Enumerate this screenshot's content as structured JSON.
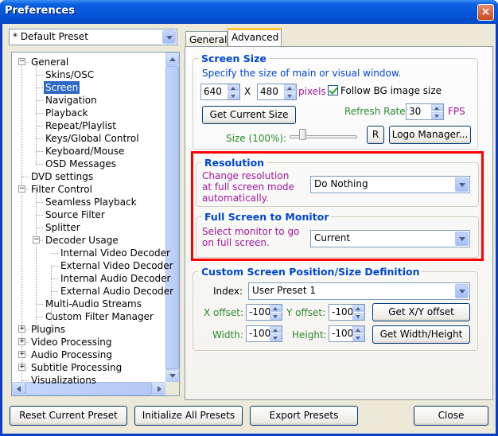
{
  "window": {
    "title": "Preferences",
    "close_glyph": "×"
  },
  "preset": {
    "selected": "* Default Preset"
  },
  "tree": {
    "items": [
      {
        "label": "General",
        "expander": "−"
      },
      {
        "label": "Skins/OSC"
      },
      {
        "label": "Screen"
      },
      {
        "label": "Navigation"
      },
      {
        "label": "Playback"
      },
      {
        "label": "Repeat/Playlist"
      },
      {
        "label": "Keys/Global Control"
      },
      {
        "label": "Keyboard/Mouse"
      },
      {
        "label": "OSD Messages"
      },
      {
        "label": "DVD settings"
      },
      {
        "label": "Filter Control",
        "expander": "−"
      },
      {
        "label": "Seamless Playback"
      },
      {
        "label": "Source Filter"
      },
      {
        "label": "Splitter"
      },
      {
        "label": "Decoder Usage",
        "expander": "−"
      },
      {
        "label": "Internal Video Decoder"
      },
      {
        "label": "External Video Decoder"
      },
      {
        "label": "Internal Audio Decoder"
      },
      {
        "label": "External Audio Decoder"
      },
      {
        "label": "Multi-Audio Streams"
      },
      {
        "label": "Custom Filter Manager"
      },
      {
        "label": "Plugins",
        "expander": "+"
      },
      {
        "label": "Video Processing",
        "expander": "+"
      },
      {
        "label": "Audio Processing",
        "expander": "+"
      },
      {
        "label": "Subtitle Processing",
        "expander": "+"
      },
      {
        "label": "Visualizations"
      }
    ],
    "selected": "Screen"
  },
  "tabs": [
    {
      "label": "General"
    },
    {
      "label": "Advanced"
    }
  ],
  "screen_size": {
    "title": "Screen Size",
    "description": "Specify the size of main or visual window.",
    "width": "640",
    "x_label": "X",
    "height": "480",
    "unit": "pixels",
    "follow_bg_label": "Follow BG image size",
    "follow_bg_checked": true,
    "get_current_label": "Get Current Size",
    "refresh_label": "Refresh Rate:",
    "refresh_value": "30",
    "fps_label": "FPS",
    "size_label": "Size (100%):",
    "r_label": "R",
    "logo_manager_label": "Logo Manager..."
  },
  "resolution": {
    "title": "Resolution",
    "desc_line1": "Change resolution",
    "desc_line2": "at full screen mode",
    "desc_line3": "automatically.",
    "selected": "Do Nothing"
  },
  "full_screen": {
    "title": "Full Screen to Monitor",
    "desc_line1": "Select monitor to go",
    "desc_line2": "on full screen.",
    "selected": "Current"
  },
  "custom_pos": {
    "title": "Custom Screen Position/Size Definition",
    "index_label": "Index:",
    "index_value": "User Preset 1",
    "x_offset_label": "X offset:",
    "x_offset_value": "-100",
    "y_offset_label": "Y offset:",
    "y_offset_value": "-100",
    "get_xy_label": "Get X/Y offset",
    "width_label": "Width:",
    "width_value": "-100",
    "height_label": "Height:",
    "height_value": "-100",
    "get_wh_label": "Get Width/Height"
  },
  "footer": {
    "reset_label": "Reset Current Preset",
    "init_label": "Initialize All Presets",
    "export_label": "Export Presets",
    "close_label": "Close"
  },
  "colors": {
    "title_bar": "#0553d8",
    "group_title": "#0046d5",
    "highlight_box": "#ff0000",
    "selected_item": "#316ac5"
  }
}
